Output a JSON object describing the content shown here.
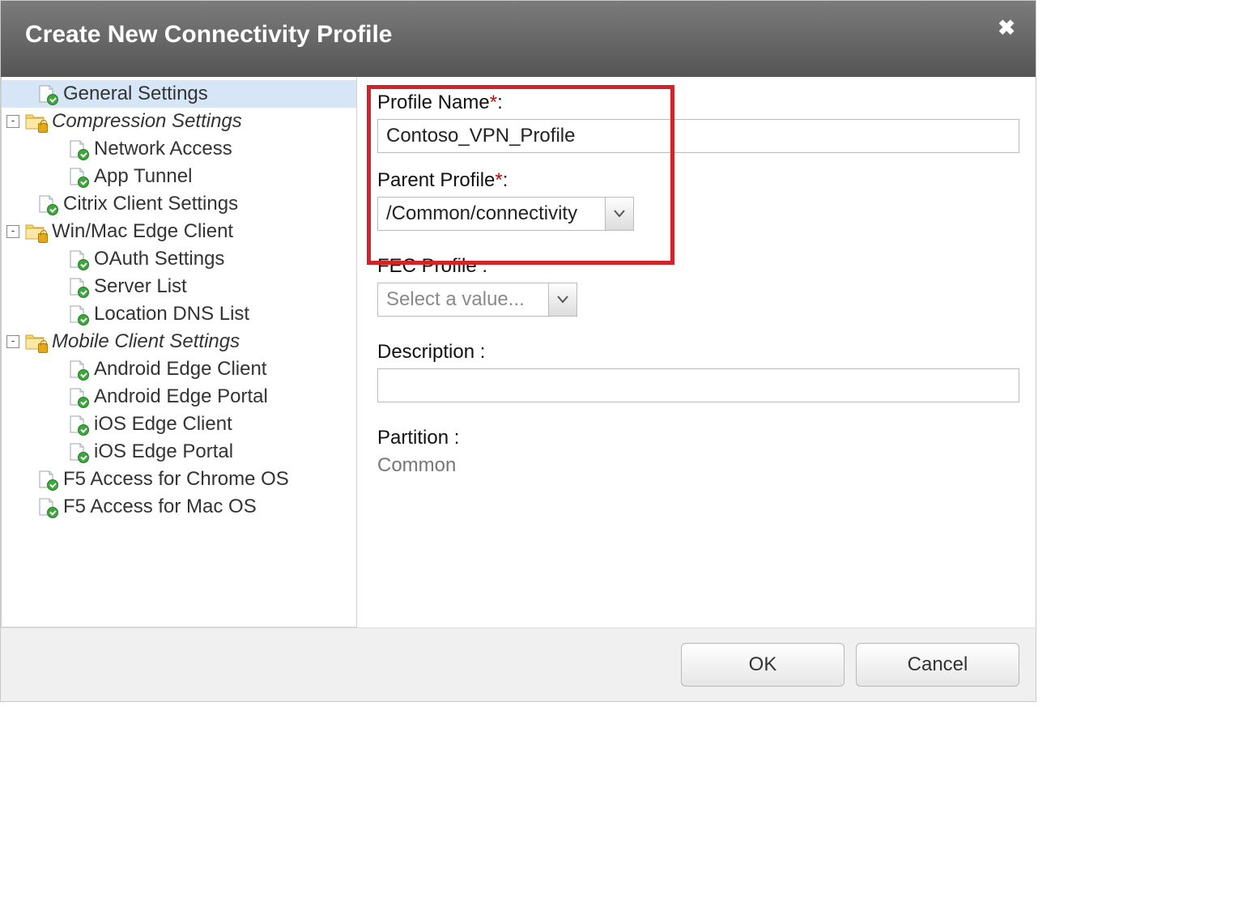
{
  "dialog": {
    "title": "Create New Connectivity Profile",
    "close_label": "Close"
  },
  "sidebar": {
    "items": [
      {
        "label": "General Settings",
        "type": "doc",
        "depth": 1,
        "selected": true,
        "expander": ""
      },
      {
        "label": "Compression Settings",
        "type": "folder",
        "depth": 0,
        "italic": true,
        "expander": "-"
      },
      {
        "label": "Network Access",
        "type": "doc",
        "depth": 2,
        "expander": ""
      },
      {
        "label": "App Tunnel",
        "type": "doc",
        "depth": 2,
        "expander": ""
      },
      {
        "label": "Citrix Client Settings",
        "type": "doc",
        "depth": 1,
        "expander": ""
      },
      {
        "label": "Win/Mac Edge Client",
        "type": "folder",
        "depth": 0,
        "expander": "-"
      },
      {
        "label": "OAuth Settings",
        "type": "doc",
        "depth": 2,
        "expander": ""
      },
      {
        "label": "Server List",
        "type": "doc",
        "depth": 2,
        "expander": ""
      },
      {
        "label": "Location DNS List",
        "type": "doc",
        "depth": 2,
        "expander": ""
      },
      {
        "label": "Mobile Client Settings",
        "type": "folder",
        "depth": 0,
        "italic": true,
        "expander": "-"
      },
      {
        "label": "Android Edge Client",
        "type": "doc",
        "depth": 2,
        "expander": ""
      },
      {
        "label": "Android Edge Portal",
        "type": "doc",
        "depth": 2,
        "expander": ""
      },
      {
        "label": "iOS Edge Client",
        "type": "doc",
        "depth": 2,
        "expander": ""
      },
      {
        "label": "iOS Edge Portal",
        "type": "doc",
        "depth": 2,
        "expander": ""
      },
      {
        "label": "F5 Access for Chrome OS",
        "type": "doc",
        "depth": 1,
        "expander": ""
      },
      {
        "label": "F5 Access for Mac OS",
        "type": "doc",
        "depth": 1,
        "expander": ""
      }
    ]
  },
  "form": {
    "profile_name": {
      "label": "Profile Name",
      "required": true,
      "value": "Contoso_VPN_Profile"
    },
    "parent_profile": {
      "label": "Parent Profile",
      "required": true,
      "value": "/Common/connectivity"
    },
    "fec_profile": {
      "label": "FEC Profile",
      "required": false,
      "placeholder": "Select a value..."
    },
    "description": {
      "label": "Description",
      "required": false,
      "value": ""
    },
    "partition": {
      "label": "Partition",
      "value": "Common"
    }
  },
  "footer": {
    "ok": "OK",
    "cancel": "Cancel"
  },
  "glyph": {
    "colon": " :",
    "asterisk": "*"
  }
}
